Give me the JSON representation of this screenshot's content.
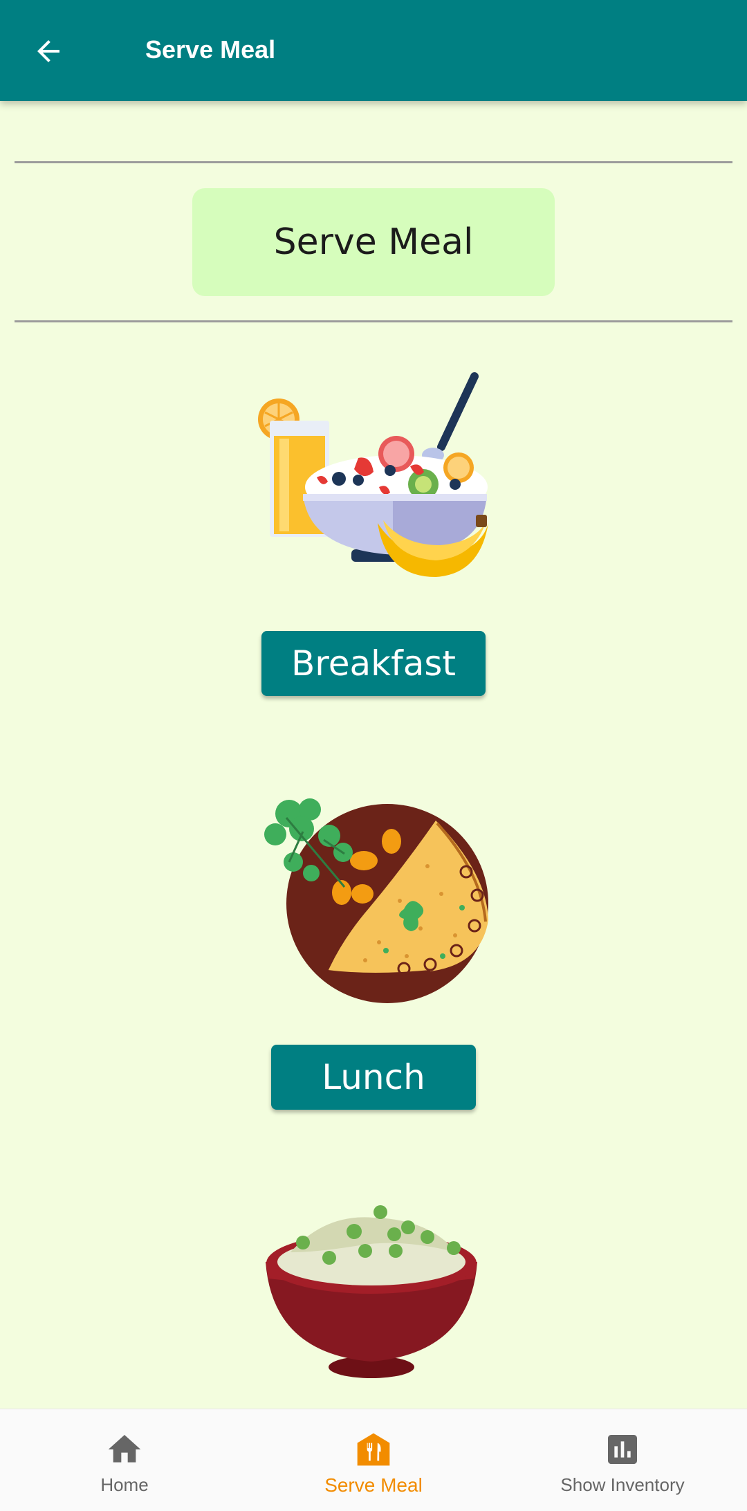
{
  "appbar": {
    "title": "Serve Meal",
    "back_icon": "arrow-left-icon"
  },
  "heading": {
    "text": "Serve Meal"
  },
  "meals": [
    {
      "label": "Breakfast",
      "image": "breakfast-bowl-image"
    },
    {
      "label": "Lunch",
      "image": "lunch-plate-image"
    },
    {
      "label": "",
      "image": "dinner-bowl-image"
    }
  ],
  "bottom_nav": {
    "items": [
      {
        "label": "Home",
        "icon": "home-icon",
        "active": false
      },
      {
        "label": "Serve Meal",
        "icon": "serve-meal-icon",
        "active": true
      },
      {
        "label": "Show Inventory",
        "icon": "bar-chart-icon",
        "active": false
      }
    ]
  },
  "colors": {
    "primary": "#007f82",
    "background": "#f3fdde",
    "heading_card": "#d6fdbc",
    "active_nav": "#f28c00",
    "inactive_nav": "#666666"
  }
}
